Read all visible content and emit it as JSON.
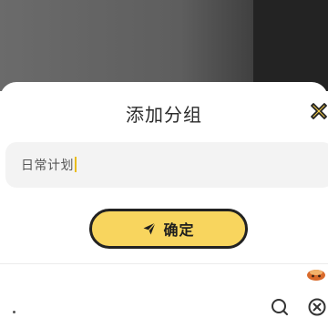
{
  "dialog": {
    "title": "添加分组",
    "close_icon": "close-icon"
  },
  "group_input": {
    "value": "日常计划"
  },
  "confirm_button": {
    "label": "确定",
    "icon": "send-icon"
  },
  "bottom_bar": {
    "search_icon": "search-icon",
    "clear_icon": "clear-icon"
  },
  "colors": {
    "accent": "#f8d55e",
    "caret": "#e9bc1d",
    "outline": "#222222"
  }
}
